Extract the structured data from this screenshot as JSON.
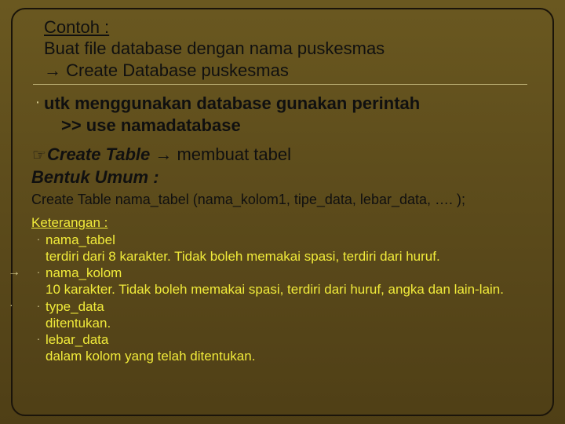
{
  "header": {
    "title": "Contoh :",
    "line1": "Buat file database dengan nama puskesmas",
    "line2": "→ Create Database puskesmas"
  },
  "section1": {
    "text_a": "utk menggunakan database gunakan perintah",
    "text_b": ">> use namadatabase"
  },
  "section2": {
    "bullet": "☞",
    "create_table_em": "Create Table",
    "arrow": " → ",
    "create_table_rest": "membuat tabel",
    "bentuk": "Bentuk Umum :",
    "syntax": "Create Table nama_tabel (nama_kolom1, tipe_data, lebar_data, …. );"
  },
  "ket": {
    "title": "Keterangan :",
    "items": [
      {
        "term": "nama_tabel",
        "desc": "terdiri dari 8 karakter. Tidak boleh memakai spasi, terdiri dari huruf."
      },
      {
        "term": "nama_kolom",
        "desc": "10 karakter. Tidak boleh memakai spasi, terdiri dari huruf, angka dan lain-lain."
      },
      {
        "term": "type_data",
        "desc": "ditentukan."
      },
      {
        "term": "lebar_data",
        "desc": "dalam kolom yang telah ditentukan."
      }
    ]
  },
  "glyphs": {
    "dot": "·",
    "arrow_out": "→"
  }
}
